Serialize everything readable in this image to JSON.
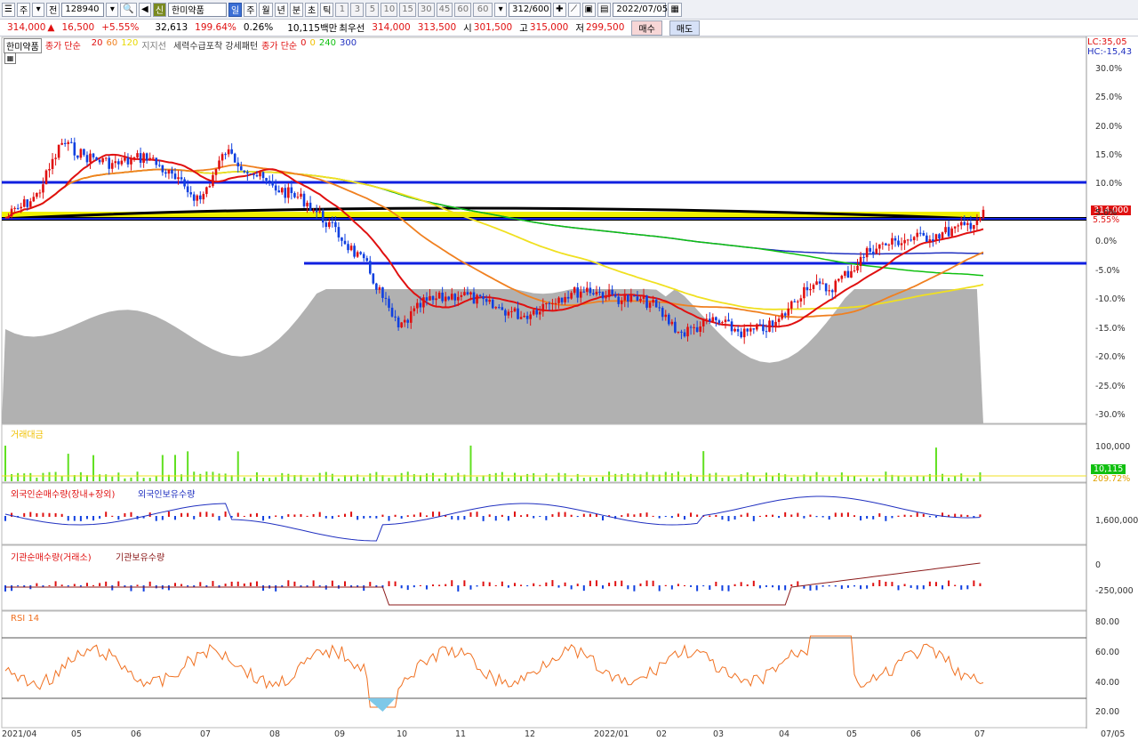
{
  "toolbar": {
    "market": "주",
    "scope": "전",
    "code": "128940",
    "stock_badge": "신",
    "stock_name": "한미약품",
    "periods": [
      "일",
      "주",
      "월",
      "년",
      "분",
      "초",
      "틱"
    ],
    "minute_buttons": [
      "1",
      "3",
      "5",
      "10",
      "15",
      "30",
      "45",
      "60",
      "60"
    ],
    "count": "312/600",
    "date": "2022/07/05"
  },
  "ticker": {
    "price": "314,000",
    "change": "16,500",
    "change_pct": "+5.55%",
    "volume": "32,613",
    "vol_ratio": "199.64%",
    "turnover": "0.26%",
    "amount": "10,115백만",
    "best_quote": "최우선",
    "bid_ask": "314,000",
    "ask2": "313,500",
    "open_label": "시",
    "open": "301,500",
    "high_label": "고",
    "high": "315,000",
    "low_label": "저",
    "low": "299,500",
    "buy_label": "매수",
    "sell_label": "매도"
  },
  "legend": {
    "name": "한미약품",
    "ma_label": "종가 단순",
    "ma_periods": [
      "20",
      "60",
      "120"
    ],
    "support": "지지선",
    "pattern": "세력수급포착 강세패턴",
    "ma2_label": "종가 단순",
    "ma2_periods": [
      "0",
      "0",
      "240",
      "300"
    ],
    "lc": "LC:35,05",
    "hc": "HC:-15,43",
    "price_tag": "314,000",
    "pct_tag": "5.55%"
  },
  "colors": {
    "up": "#e01010",
    "down": "#1040e0",
    "ma20": "#e01010",
    "ma60": "#f08020",
    "ma120": "#f0e020",
    "ma240": "#10c010",
    "ma300": "#2030c0",
    "hline": "#1020e0",
    "band": "#f0f000",
    "volume": "#60e020",
    "rsi": "#f07020"
  },
  "y_ticks": [
    "30.0%",
    "25.0%",
    "20.0%",
    "15.0%",
    "10.0%",
    "5.0%",
    "0.0%",
    "-5.0%",
    "-10.0%",
    "-15.0%",
    "-20.0%",
    "-25.0%",
    "-30.0%"
  ],
  "x_ticks": [
    "2021/04",
    "05",
    "06",
    "07",
    "08",
    "09",
    "10",
    "11",
    "12",
    "2022/01",
    "02",
    "03",
    "04",
    "05",
    "06",
    "07"
  ],
  "x_right": "07/05",
  "panels": {
    "volume": {
      "title": "거래대금",
      "ticks": [
        "100,000"
      ],
      "value": "10,115",
      "value2": "209.72%"
    },
    "foreign": {
      "title": "외국인순매수량(장내+장외)",
      "title2": "외국인보유수량",
      "ticks": [
        "1,600,000"
      ]
    },
    "inst": {
      "title": "기관순매수량(거래소)",
      "title2": "기관보유수량",
      "ticks": [
        "0",
        "-250,000"
      ]
    },
    "rsi": {
      "title": "RSI 14",
      "ticks": [
        "80.00",
        "60.00",
        "40.00",
        "20.00"
      ]
    }
  }
}
